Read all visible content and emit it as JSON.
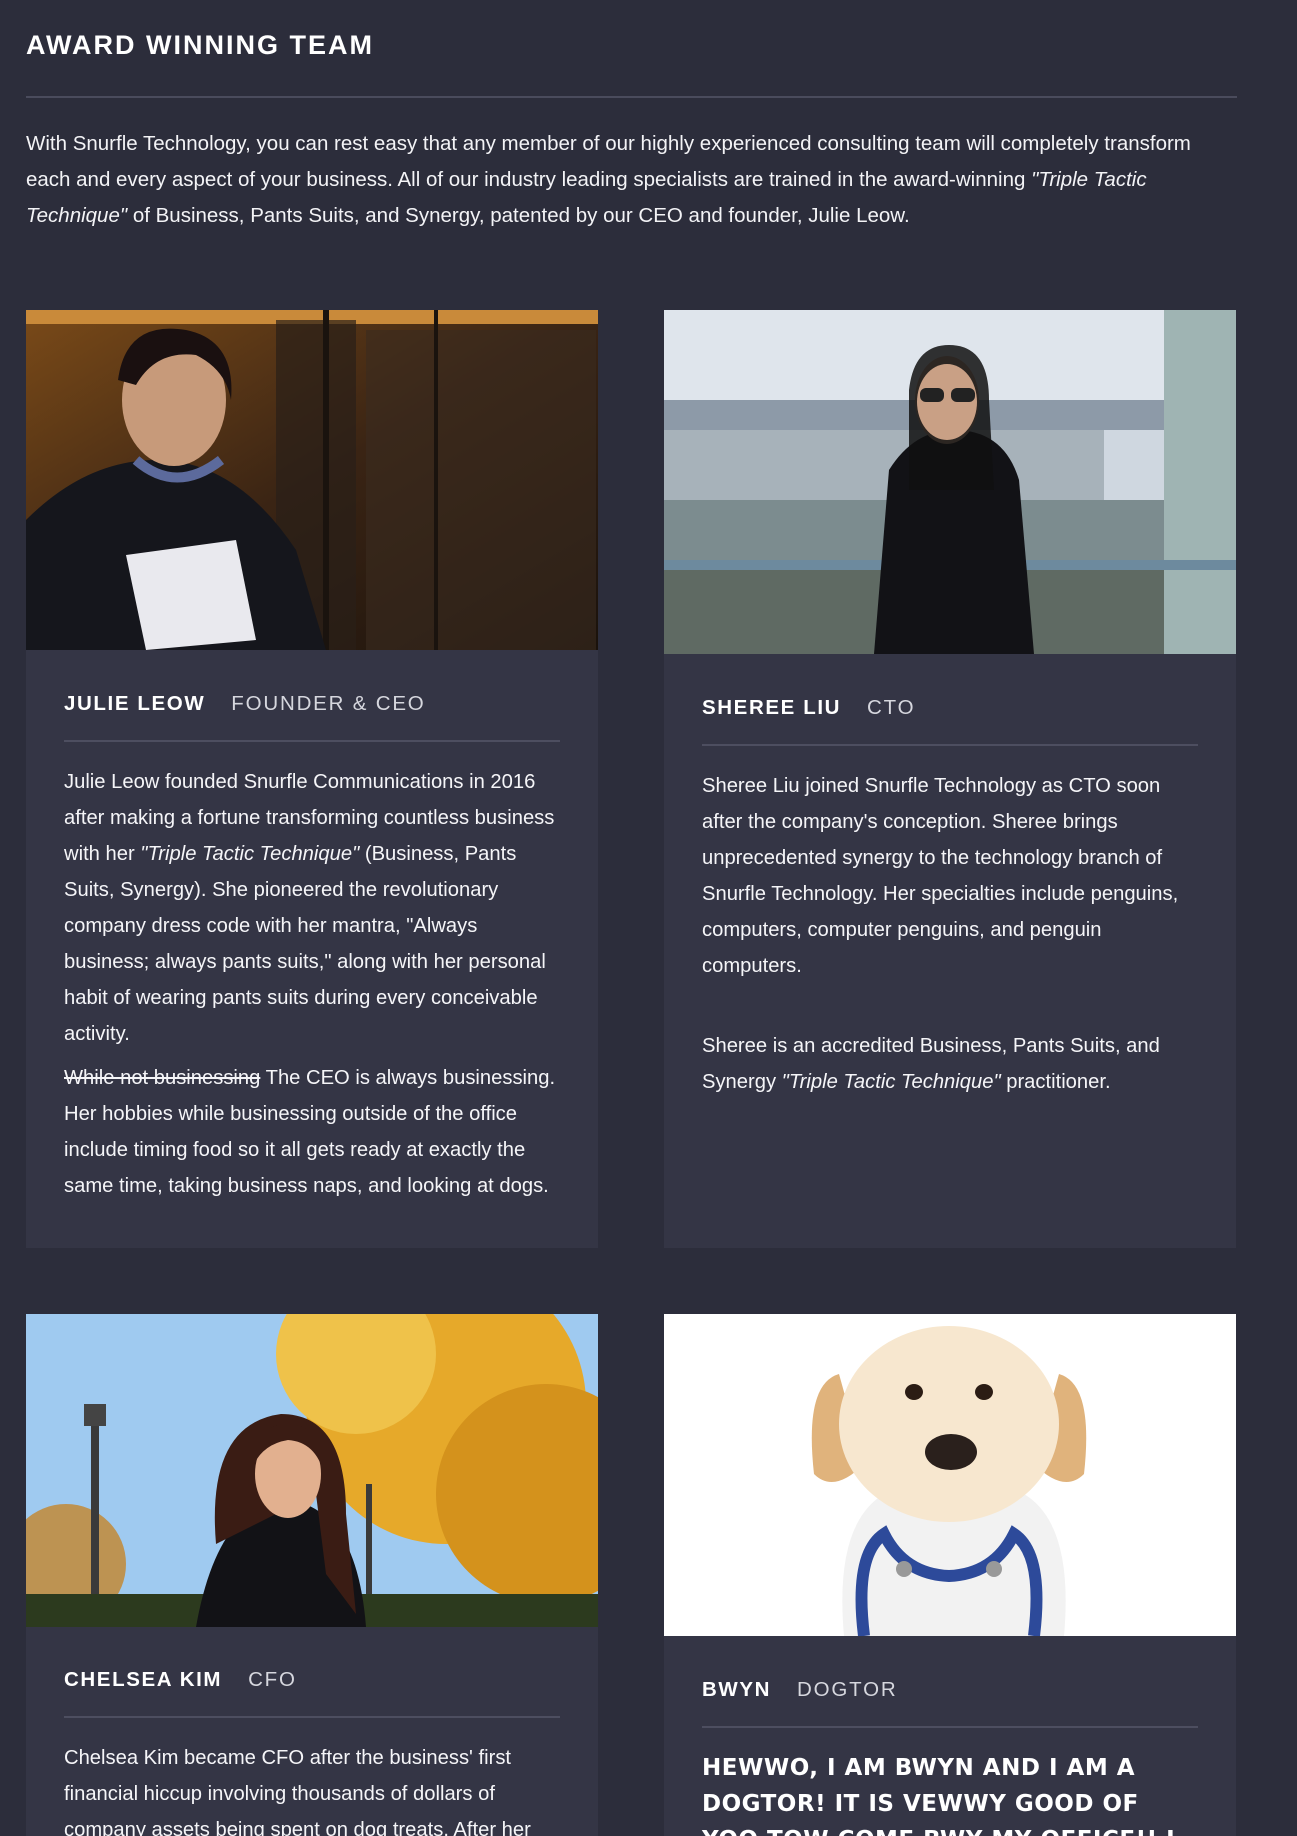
{
  "section": {
    "title": "AWARD WINNING TEAM",
    "intro_part1": "With Snurfle Technology, you can rest easy that any member of our highly experienced consulting team will completely transform each and every aspect of your business. All of our industry leading specialists are trained in the award-winning ",
    "intro_emphasis": "\"Triple Tactic Technique\"",
    "intro_part2": " of Business, Pants Suits, and Synergy, patented by our CEO and founder, Julie Leow."
  },
  "team": [
    {
      "name": "JULIE LEOW",
      "role": "FOUNDER & CEO",
      "bio1_a": "Julie Leow founded Snurfle Communications in 2016 after making a fortune transforming countless business with her ",
      "bio1_em": "\"Triple Tactic Technique\"",
      "bio1_b": " (Business, Pants Suits, Synergy). She pioneered the revolutionary company dress code with her mantra, \"Always business; always pants suits,\" along with her personal habit of wearing pants suits during every conceivable activity.",
      "bio2_strike": "While not businessing",
      "bio2_rest": " The CEO is always businessing. Her hobbies while businessing outside of the office include timing food so it all gets ready at exactly the same time, taking business naps, and looking at dogs."
    },
    {
      "name": "SHEREE LIU",
      "role": "CTO",
      "bio1": "Sheree Liu joined Snurfle Technology as CTO soon after the company's conception. Sheree brings unprecedented synergy to the technology branch of Snurfle Technology. Her specialties include penguins, computers, computer penguins, and penguin computers.",
      "bio2_a": "Sheree is an accredited Business, Pants Suits, and Synergy ",
      "bio2_em": "\"Triple Tactic Technique\"",
      "bio2_b": " practitioner."
    },
    {
      "name": "CHELSEA KIM",
      "role": "CFO",
      "bio1": "Chelsea Kim became CFO after the business' first financial hiccup involving thousands of dollars of company assets being spent on dog treats. After her"
    },
    {
      "name": "BWYN",
      "role": "DOGTOR",
      "bio1": "HEWWO, I AM BWYN AND I AM A DOGTOR! IT IS VEWWY GOOD OF YOO TOW COME BWY MY OFFICE!! I HAVE HAD SEOWSE"
    }
  ]
}
